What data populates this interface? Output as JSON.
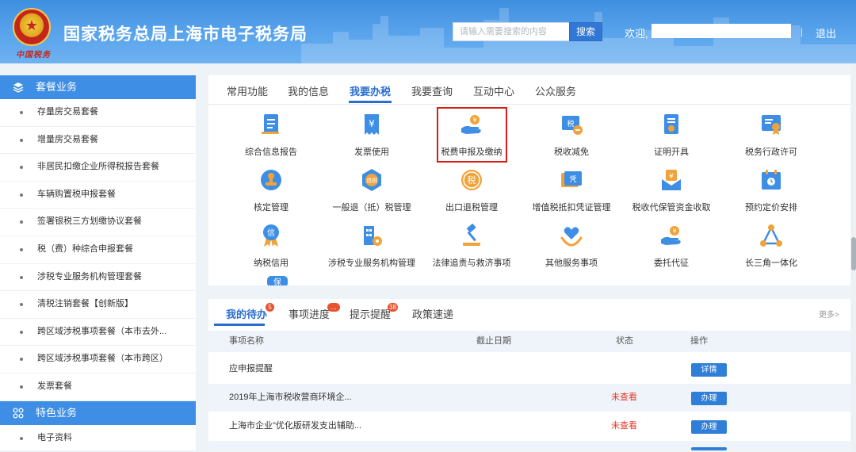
{
  "header": {
    "title": "国家税务总局上海市电子税务局",
    "brand_signature": "中国税务",
    "search_placeholder": "请输入需要搜索的内容",
    "search_button": "搜索",
    "welcome": "欢迎,",
    "separator": "|",
    "logout": "退出"
  },
  "sidebar": {
    "sections": [
      {
        "title": "套餐业务",
        "icon": "layers-icon",
        "items": [
          {
            "label": "存量房交易套餐"
          },
          {
            "label": "增量房交易套餐"
          },
          {
            "label": "非居民扣缴企业所得税报告套餐"
          },
          {
            "label": "车辆购置税申报套餐"
          },
          {
            "label": "签署银税三方划缴协议套餐"
          },
          {
            "label": "税（费）种综合申报套餐"
          },
          {
            "label": "涉税专业服务机构管理套餐"
          },
          {
            "label": "清税注销套餐【创新版】"
          },
          {
            "label": "跨区域涉税事项套餐（本市去外..."
          },
          {
            "label": "跨区域涉税事项套餐（本市跨区）"
          },
          {
            "label": "发票套餐"
          }
        ]
      },
      {
        "title": "特色业务",
        "icon": "grid-icon",
        "items": [
          {
            "label": "电子资料"
          }
        ]
      }
    ]
  },
  "main": {
    "tabs": [
      {
        "label": "常用功能"
      },
      {
        "label": "我的信息"
      },
      {
        "label": "我要办税",
        "active": true
      },
      {
        "label": "我要查询"
      },
      {
        "label": "互动中心"
      },
      {
        "label": "公众服务"
      }
    ],
    "services": [
      {
        "label": "综合信息报告",
        "icon": "report-icon"
      },
      {
        "label": "发票使用",
        "icon": "invoice-icon"
      },
      {
        "label": "税费申报及缴纳",
        "icon": "payment-hand-icon",
        "highlighted": true
      },
      {
        "label": "税收减免",
        "icon": "tax-relief-icon"
      },
      {
        "label": "证明开具",
        "icon": "certificate-icon"
      },
      {
        "label": "税务行政许可",
        "icon": "license-icon"
      },
      {
        "label": "核定管理",
        "icon": "stamp-icon"
      },
      {
        "label": "一般退（抵）税管理",
        "icon": "refund-icon",
        "icon_text": "退税"
      },
      {
        "label": "出口退税管理",
        "icon": "export-refund-icon",
        "icon_text": "税"
      },
      {
        "label": "增值税抵扣凭证管理",
        "icon": "voucher-icon",
        "icon_text": "凭"
      },
      {
        "label": "税收代保管资金收取",
        "icon": "custody-fund-icon"
      },
      {
        "label": "预约定价安排",
        "icon": "calendar-icon"
      },
      {
        "label": "纳税信用",
        "icon": "credit-badge-icon",
        "icon_text": "信"
      },
      {
        "label": "涉税专业服务机构管理",
        "icon": "agency-building-icon"
      },
      {
        "label": "法律追责与救济事项",
        "icon": "gavel-icon"
      },
      {
        "label": "其他服务事项",
        "icon": "heart-hands-icon"
      },
      {
        "label": "委托代征",
        "icon": "payment-hand-icon"
      },
      {
        "label": "长三角一体化",
        "icon": "triangle-network-icon"
      }
    ],
    "partial_icon_text": "保"
  },
  "pending": {
    "tabs": [
      {
        "label": "我的待办",
        "badge": "5",
        "active": true
      },
      {
        "label": "事项进度",
        "badge": "..."
      },
      {
        "label": "提示提醒",
        "badge": "38"
      },
      {
        "label": "政策速递"
      }
    ],
    "more": "更多>",
    "columns": [
      "事项名称",
      "截止日期",
      "状态",
      "操作"
    ],
    "rows": [
      {
        "name": "应申报提醒",
        "deadline": "",
        "status": "",
        "action": "详情"
      },
      {
        "name": "2019年上海市税收营商环境企...",
        "deadline": "",
        "status": "未查看",
        "action": "办理"
      },
      {
        "name": "上海市企业\"优化版研发支出辅助...",
        "deadline": "",
        "status": "未查看",
        "action": "办理"
      }
    ]
  },
  "colors": {
    "header_blue": "#4a98e6",
    "accent": "#2a6fcf",
    "icon_blue": "#3d8ee4",
    "icon_orange": "#f0a33a",
    "highlight_red": "#d91e18",
    "status_red": "#e2382a"
  }
}
